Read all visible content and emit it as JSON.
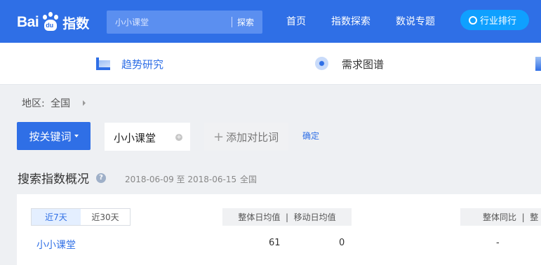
{
  "header": {
    "logo": {
      "bai": "Bai",
      "du": "du",
      "zhishu": "指数"
    },
    "search": {
      "placeholder": "小小课堂",
      "button": "探索"
    },
    "nav": [
      "首页",
      "指数探索",
      "数说专题"
    ],
    "ranking_button": "行业排行"
  },
  "subnav": {
    "items": [
      "趋势研究",
      "需求图谱"
    ]
  },
  "region": {
    "label": "地区:",
    "value": "全国"
  },
  "keyword_controls": {
    "mode_button": "按关键词",
    "keyword": "小小课堂",
    "add_compare": "添加对比词",
    "confirm": "确定"
  },
  "overview": {
    "title": "搜索指数概况",
    "date_range": "2018-06-09 至 2018-06-15",
    "region": "全国",
    "tabs": [
      "近7天",
      "近30天"
    ],
    "header_group1": "整体日均值  |  移动日均值",
    "header_group2": "整体同比  |  整",
    "row": {
      "keyword": "小小课堂",
      "overall_avg": "61",
      "mobile_avg": "0",
      "overall_yoy": "-"
    }
  },
  "colors": {
    "brand_blue": "#2f6fe6",
    "pill_blue": "#0fa0ff"
  }
}
